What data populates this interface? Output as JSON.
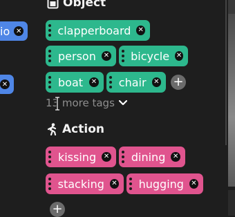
{
  "left_chips": [
    {
      "label": "io"
    },
    {
      "label": ""
    }
  ],
  "sections": {
    "object": {
      "title": "Object",
      "tags": [
        "clapperboard",
        "person",
        "bicycle",
        "boat",
        "chair"
      ],
      "more_tags_label": "13 more tags"
    },
    "action": {
      "title": "Action",
      "tags": [
        "kissing",
        "dining",
        "stacking",
        "hugging"
      ]
    }
  },
  "colors": {
    "object_chip": "#2db88d",
    "action_chip": "#e0548e",
    "left_chip": "#4f86e6",
    "background": "#1e1e1e"
  },
  "icons": {
    "object": "box-icon",
    "action": "person-action-icon",
    "remove": "close-icon",
    "add": "plus-icon",
    "expand": "chevron-down-icon",
    "drag": "drag-handle-icon"
  }
}
